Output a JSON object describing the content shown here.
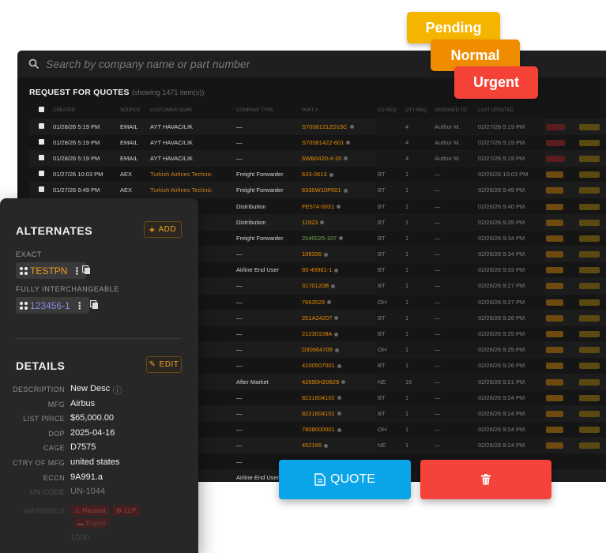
{
  "search": {
    "placeholder": "Search by company name or part number"
  },
  "rfq": {
    "title": "REQUEST FOR QUOTES",
    "subtitle": "(showing 1471 item(s))",
    "columns": [
      "",
      "CREATED",
      "SOURCE",
      "CUSTOMER NAME",
      "COMPANY TYPE",
      "PART #",
      "CD REQ",
      "QTY REQ",
      "ASSIGNED TO",
      "LAST UPDATED",
      "",
      ""
    ],
    "rows": [
      {
        "created": "01/28/26 5:19 PM",
        "source": "EMAIL",
        "customer": "AYT HAVACILIK",
        "ctype": "—",
        "part": "S70081212D15C",
        "cd": "",
        "qty": "4",
        "assigned": "Authur M.",
        "updated": "02/27/26 5:19 PM"
      },
      {
        "created": "01/28/26 5:19 PM",
        "source": "EMAIL",
        "customer": "AYT HAVACILIK",
        "ctype": "—",
        "part": "S70081422-601",
        "cd": "",
        "qty": "4",
        "assigned": "Authur M.",
        "updated": "02/27/26 5:19 PM"
      },
      {
        "created": "01/28/26 5:19 PM",
        "source": "EMAIL",
        "customer": "AYT HAVACILIK",
        "ctype": "—",
        "part": "6WB0420-4-20",
        "cd": "",
        "qty": "4",
        "assigned": "Authur M.",
        "updated": "02/27/26 5:19 PM"
      },
      {
        "created": "01/27/26 10:03 PM",
        "source": "AEX",
        "customer": "Turkish Airlines Technic",
        "ctype": "Freight Forwarder",
        "part": "633-0613",
        "cd": "BT",
        "qty": "1",
        "assigned": "—",
        "updated": "02/26/26 10:03 PM"
      },
      {
        "created": "01/27/26 9:49 PM",
        "source": "AEX",
        "customer": "Turkish Airlines Technic",
        "ctype": "Freight Forwarder",
        "part": "6330W10P001",
        "cd": "BT",
        "qty": "1",
        "assigned": "—",
        "updated": "02/26/26 9:49 PM"
      },
      {
        "created": "",
        "source": "",
        "customer": "vices",
        "ctype": "Distribution",
        "part": "FE574-0031",
        "cd": "BT",
        "qty": "1",
        "assigned": "—",
        "updated": "02/26/26 9:40 PM"
      },
      {
        "created": "",
        "source": "",
        "customer": "vices",
        "ctype": "Distribution",
        "part": "11923",
        "cd": "BT",
        "qty": "1",
        "assigned": "—",
        "updated": "02/26/26 9:35 PM"
      },
      {
        "created": "",
        "source": "",
        "customer": "chnic",
        "ctype": "Freight Forwarder",
        "part": "2040025-107",
        "cd": "BT",
        "qty": "1",
        "assigned": "—",
        "updated": "02/26/26 9:34 PM"
      },
      {
        "created": "",
        "source": "",
        "customer": "mation",
        "ctype": "—",
        "part": "109336",
        "cd": "BT",
        "qty": "1",
        "assigned": "—",
        "updated": "02/26/26 9:34 PM"
      },
      {
        "created": "",
        "source": "",
        "customer": "",
        "ctype": "Airline End User",
        "part": "65-49961-1",
        "cd": "BT",
        "qty": "1",
        "assigned": "—",
        "updated": "02/26/26 9:33 PM"
      },
      {
        "created": "",
        "source": "",
        "customer": "",
        "ctype": "—",
        "part": "3170120B",
        "cd": "BT",
        "qty": "1",
        "assigned": "—",
        "updated": "02/26/26 9:27 PM"
      },
      {
        "created": "",
        "source": "",
        "customer": "",
        "ctype": "—",
        "part": "7663528",
        "cd": "OH",
        "qty": "1",
        "assigned": "—",
        "updated": "02/26/26 9:27 PM"
      },
      {
        "created": "",
        "source": "",
        "customer": "",
        "ctype": "—",
        "part": "251A24207",
        "cd": "BT",
        "qty": "1",
        "assigned": "—",
        "updated": "02/26/26 9:26 PM"
      },
      {
        "created": "",
        "source": "",
        "customer": "",
        "ctype": "—",
        "part": "21230108A",
        "cd": "BT",
        "qty": "1",
        "assigned": "—",
        "updated": "02/26/26 9:25 PM"
      },
      {
        "created": "",
        "source": "",
        "customer": "",
        "ctype": "—",
        "part": "D30664709",
        "cd": "OH",
        "qty": "1",
        "assigned": "—",
        "updated": "02/26/26 9:25 PM"
      },
      {
        "created": "",
        "source": "",
        "customer": "",
        "ctype": "—",
        "part": "4100507001",
        "cd": "BT",
        "qty": "1",
        "assigned": "—",
        "updated": "02/26/26 9:26 PM"
      },
      {
        "created": "",
        "source": "",
        "customer": "",
        "ctype": "After Market",
        "part": "42690H20629",
        "cd": "NE",
        "qty": "16",
        "assigned": "—",
        "updated": "02/26/26 9:21 PM"
      },
      {
        "created": "",
        "source": "",
        "customer": "",
        "ctype": "—",
        "part": "8221604102",
        "cd": "BT",
        "qty": "1",
        "assigned": "—",
        "updated": "02/26/26 9:24 PM"
      },
      {
        "created": "",
        "source": "",
        "customer": "",
        "ctype": "—",
        "part": "8221604101",
        "cd": "BT",
        "qty": "1",
        "assigned": "—",
        "updated": "02/26/26 9:24 PM"
      },
      {
        "created": "",
        "source": "",
        "customer": "",
        "ctype": "—",
        "part": "7808000001",
        "cd": "OH",
        "qty": "1",
        "assigned": "—",
        "updated": "02/26/26 9:24 PM"
      },
      {
        "created": "",
        "source": "",
        "customer": "",
        "ctype": "—",
        "part": "452166",
        "cd": "NE",
        "qty": "1",
        "assigned": "—",
        "updated": "02/26/26 9:24 PM"
      },
      {
        "created": "",
        "source": "",
        "customer": "",
        "ctype": "—",
        "part": "",
        "cd": "",
        "qty": "",
        "assigned": "",
        "updated": ""
      },
      {
        "created": "",
        "source": "",
        "customer": "es",
        "ctype": "Airline End User",
        "part": "",
        "cd": "",
        "qty": "",
        "assigned": "",
        "updated": ""
      }
    ]
  },
  "badges": {
    "pending": "Pending",
    "normal": "Normal",
    "urgent": "Urgent"
  },
  "alternates": {
    "title": "ALTERNATES",
    "add_label": "ADD",
    "exact_label": "EXACT",
    "exact_part": "TESTPN",
    "interchangeable_label": "FULLY INTERCHANGEABLE",
    "interchangeable_part": "123456-1"
  },
  "details": {
    "title": "DETAILS",
    "edit_label": "EDIT",
    "rows": [
      {
        "key": "DESCRIPTION",
        "value": "New Desc"
      },
      {
        "key": "MFG",
        "value": "Airbus"
      },
      {
        "key": "LIST PRICE",
        "value": "$65,000.00"
      },
      {
        "key": "DOP",
        "value": "2025-04-16"
      },
      {
        "key": "CAGE",
        "value": "D7575"
      },
      {
        "key": "CTRY OF MFG",
        "value": "united states"
      },
      {
        "key": "ECCN",
        "value": "9A991.a"
      },
      {
        "key": "UN CODE",
        "value": "UN-1044"
      }
    ],
    "warnings_label": "WARNINGS",
    "warnings": [
      "Hazmat",
      "LLP",
      "Export"
    ],
    "faded_value": "1000"
  },
  "actions": {
    "quote_label": "QUOTE"
  },
  "colors": {
    "accent_orange": "#f0a020",
    "quote_blue": "#0aa4e8",
    "delete_red": "#f4433a",
    "pending": "#f4b400",
    "normal": "#f08c00",
    "urgent": "#f44336"
  }
}
